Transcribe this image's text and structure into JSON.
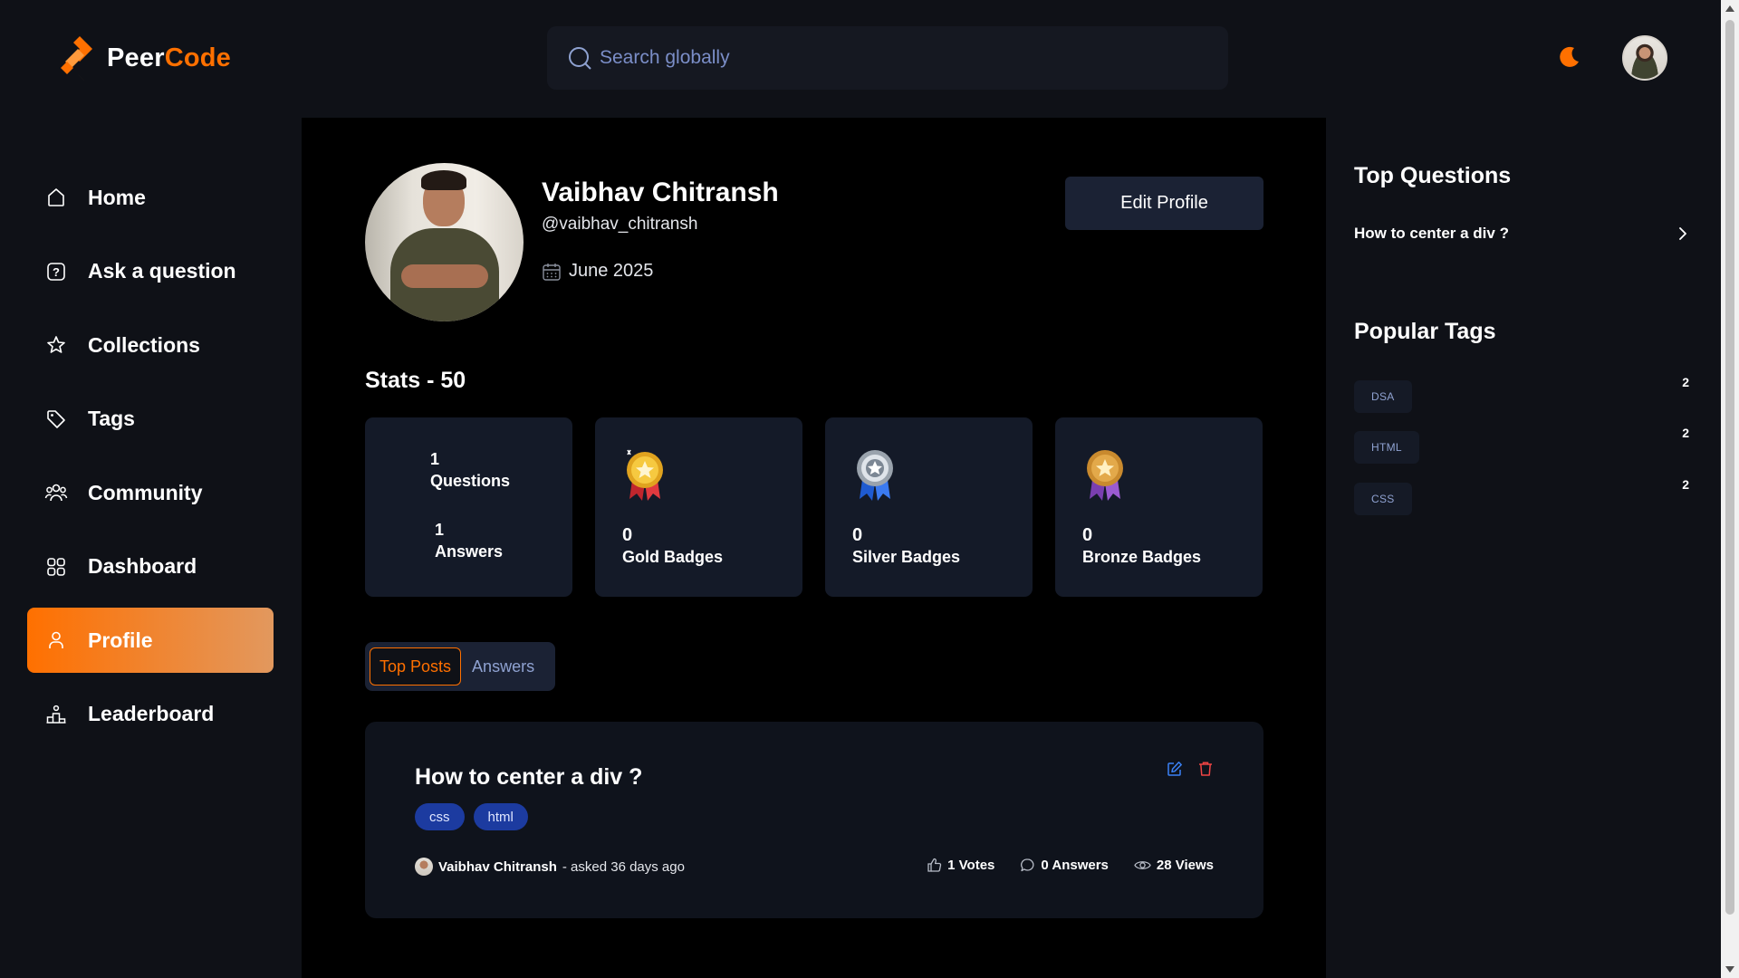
{
  "brand": {
    "part1": "Peer",
    "part2": "Code",
    "accent": "#ff7000"
  },
  "search": {
    "placeholder": "Search  globally"
  },
  "sidebar": {
    "items": [
      {
        "label": "Home",
        "icon": "home-icon"
      },
      {
        "label": "Ask a question",
        "icon": "question-icon"
      },
      {
        "label": "Collections",
        "icon": "star-icon"
      },
      {
        "label": "Tags",
        "icon": "tag-icon"
      },
      {
        "label": "Community",
        "icon": "users-icon"
      },
      {
        "label": "Dashboard",
        "icon": "grid-icon"
      },
      {
        "label": "Profile",
        "icon": "user-icon",
        "active": true
      },
      {
        "label": "Leaderboard",
        "icon": "leaderboard-icon"
      }
    ]
  },
  "profile": {
    "name": "Vaibhav Chitransh",
    "username": "@vaibhav_chitransh",
    "joined": "June 2025",
    "edit_label": "Edit Profile"
  },
  "stats": {
    "title": "Stats - 50",
    "questions_count": "1",
    "questions_label": "Questions",
    "answers_count": "1",
    "answers_label": "Answers",
    "gold_count": "0",
    "gold_label": "Gold Badges",
    "silver_count": "0",
    "silver_label": "Silver Badges",
    "bronze_count": "0",
    "bronze_label": "Bronze Badges"
  },
  "tabs": {
    "top_posts": "Top Posts",
    "answers": "Answers"
  },
  "post": {
    "title": "How to center a div ?",
    "tags": [
      "css",
      "html"
    ],
    "author": "Vaibhav Chitransh",
    "asked": "- asked 36 days ago",
    "votes": "1 Votes",
    "answers": "0 Answers",
    "views": "28 Views"
  },
  "right": {
    "top_questions_title": "Top Questions",
    "top_questions": [
      "How to center a div ?"
    ],
    "popular_tags_title": "Popular Tags",
    "popular_tags": [
      {
        "name": "DSA",
        "count": "2"
      },
      {
        "name": "HTML",
        "count": "2"
      },
      {
        "name": "CSS",
        "count": "2"
      }
    ]
  }
}
